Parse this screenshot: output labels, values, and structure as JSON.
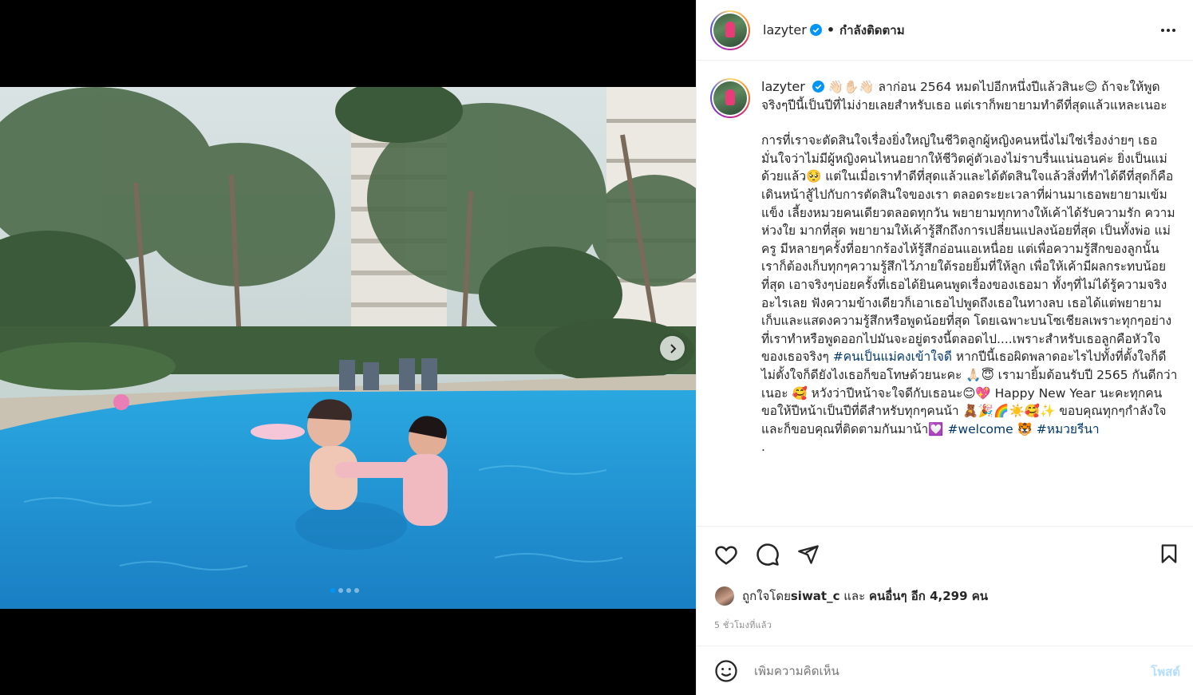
{
  "post": {
    "username": "lazyter",
    "follow_state": "กำลังติดตาม",
    "separator": "•",
    "caption_intro_emojis": "👋🏻✋🏻👋🏻",
    "caption_line1": "ลาก่อน 2564 หมดไปอีกหนึ่งปีแล้วสินะ😊 ถ้าจะให้พูดจริงๆปีนี้เป็นปีที่ไม่ง่ายเลยสำหรับเธอ แต่เราก็พยายามทำดีที่สุดแล้วแหละเนอะ",
    "caption_body": "การที่เราจะตัดสินใจเรื่องยิ่งใหญ่ในชีวิตลูกผู้หญิงคนหนึ่งไม่ใช่เรื่องง่ายๆ เธอมั่นใจว่าไม่มีผู้หญิงคนไหนอยากให้ชีวิตคู่ตัวเองไม่ราบรื่นแน่นอนค่ะ ยิ่งเป็นแม่ด้วยแล้ว🥺 แต่ในเมื่อเราทำดีที่สุดแล้วและได้ตัดสินใจแล้วสิ่งที่ทำได้ดีที่สุดก็คือเดินหน้าสู้ไปกับการตัดสินใจของเรา ตลอดระยะเวลาที่ผ่านมาเธอพยายามเข้มแข็ง เลี้ยงหมวยคนเดียวตลอดทุกวัน พยายามทุกทางให้เค้าได้รับความรัก ความห่วงใย มากที่สุด พยายามให้เค้ารู้สึกถึงการเปลี่ยนแปลงน้อยที่สุด เป็นทั้งพ่อ แม่ ครู มีหลายๆครั้งที่อยากร้องไห้รู้สึกอ่อนแอเหนื่อย แต่เพื่อความรู้สึกของลูกนั้น เราก็ต้องเก็บทุกๆความรู้สึกไว้ภายใต้รอยยิ้มที่ให้ลูก เพื่อให้เค้ามีผลกระทบน้อยที่สุด เอาจริงๆบ่อยครั้งที่เธอได้ยินคนพูดเรื่องของเธอมา ทั้งๆที่ไม่ได้รู้ความจริงอะไรเลย ฟังความข้างเดียวก็เอาเธอไปพูดถึงเธอในทางลบ เธอได้แต่พยายามเก็บและแสดงความรู้สึกหรือพูดน้อยที่สุด โดยเฉพาะบนโซเชียลเพราะทุกๆอย่างที่เราทำหรือพูดออกไปมันจะอยู่ตรงนี้ตลอดไป....เพราะสำหรับเธอลูกคือหัวใจของเธอจริงๆ ",
    "hashtag1": "#คนเป็นแม่คงเข้าใจดี",
    "caption_body2": " หากปีนี้เธอผิดพลาดอะไรไปทั้งที่ตั้งใจก็ดีไม่ตั้งใจก็ดียังไงเธอก็ขอโทษด้วยนะคะ 🙏🏻😇 เรามายิ้มต้อนรับปี 2565 กันดีกว่าเนอะ 🥰 หวังว่าปีหน้าจะใจดีกับเธอนะ😊💖 Happy New Year นะคะทุกคน ขอให้ปีหน้าเป็นปีที่ดีสำหรับทุกๆคนน้า 🧸🎉🌈☀️🥰✨ ขอบคุณทุกๆกำลังใจและก็ขอบคุณที่ติดตามกันมาน้า💟 ",
    "hashtag2": "#welcome",
    "tiger": "🐯 ",
    "hashtag3": "#หมวยรีนา",
    "caption_end": ".",
    "likes_prefix": "ถูกใจโดย ",
    "likes_user": "siwat_c",
    "likes_middle": " และ ",
    "likes_others": "คนอื่นๆ อีก 4,299 คน",
    "time_ago": "5 ชั่วโมงที่แล้ว",
    "comment_placeholder": "เพิ่มความคิดเห็น",
    "post_label": "โพสต์"
  },
  "carousel": {
    "total": 4,
    "current": 1
  },
  "colors": {
    "verified": "#0095f6",
    "hashtag": "#00376b",
    "post_button": "#b2dffc",
    "pool": "#1e9ad8"
  }
}
